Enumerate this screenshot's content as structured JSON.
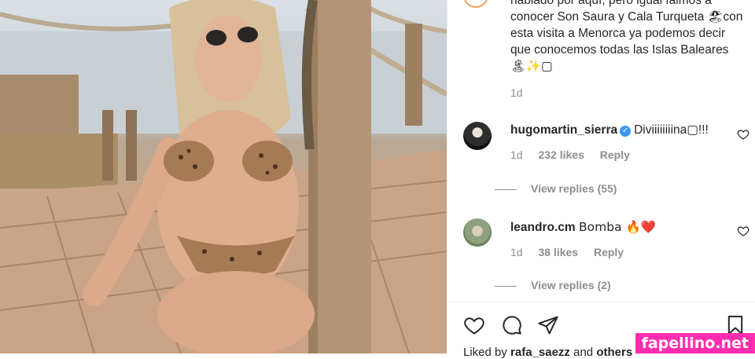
{
  "post": {
    "caption": "habiado por aquí, pero igual faimos a conocer Son Saura y Cala Turqueta 🏖con esta visita a Menorca ya podemos decir que conocemos todas las Islas Baleares 🏝✨▢",
    "age": "1d"
  },
  "comments": [
    {
      "username": "hugomartin_sierra",
      "verified": true,
      "text": "Diviiiiiiiina▢!!!",
      "age": "1d",
      "likes": "232 likes",
      "reply_label": "Reply",
      "view_replies": "View replies (55)"
    },
    {
      "username": "leandro.cm",
      "verified": false,
      "text": "Bomba 🔥❤️",
      "age": "1d",
      "likes": "38 likes",
      "reply_label": "Reply",
      "view_replies": "View replies (2)"
    }
  ],
  "icons": {
    "like": "heart-icon",
    "comment": "comment-icon",
    "share": "share-icon",
    "save": "bookmark-icon",
    "comment_like": "heart-outline-icon",
    "verified": "verified-badge-icon"
  },
  "liked_by": {
    "prefix": "Liked by",
    "user": "rafa_saezz",
    "and": "and",
    "others": "others"
  },
  "watermark": "fapellino.net",
  "colors": {
    "text": "#262626",
    "secondary": "#8e8e8e",
    "verified": "#3897f0",
    "watermark_bg": "#ff2db0"
  }
}
